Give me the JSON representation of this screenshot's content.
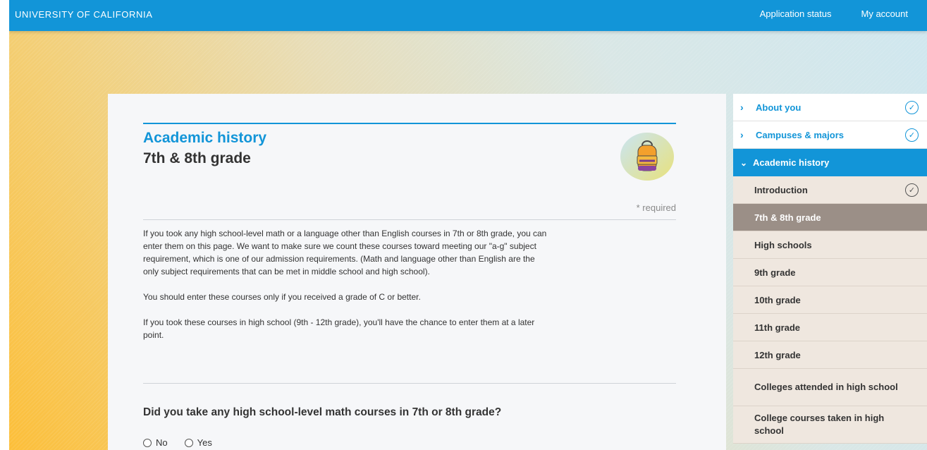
{
  "header": {
    "brand": "UNIVERSITY OF CALIFORNIA",
    "nav": [
      "Application status",
      "My account"
    ]
  },
  "page": {
    "section": "Academic history",
    "subtitle": "7th & 8th grade",
    "required_note": "* required",
    "paragraphs": [
      "If you took any high school-level math or a language other than English courses in 7th or 8th grade, you can enter them on this page. We want to make sure we count these courses toward meeting our \"a-g\" subject requirement, which is one of our admission requirements. (Math and language other than English are the only subject requirements that can be met in middle school and high school).",
      "You should enter these courses only if you received a grade of C or better.",
      "If you took these courses in high school (9th - 12th grade), you'll have the chance to enter them at a later point."
    ],
    "question": "Did you take any high school-level math courses in 7th or 8th grade?",
    "options": [
      "No",
      "Yes"
    ]
  },
  "sidebar": {
    "sections": [
      {
        "label": "About you",
        "icon": "chevron-right-icon",
        "status": "complete"
      },
      {
        "label": "Campuses & majors",
        "icon": "chevron-right-icon",
        "status": "complete"
      },
      {
        "label": "Academic history",
        "icon": "chevron-down-icon",
        "status": "open"
      }
    ],
    "subitems": [
      {
        "label": "Introduction",
        "status": "complete"
      },
      {
        "label": "7th & 8th grade",
        "status": "active"
      },
      {
        "label": "High schools"
      },
      {
        "label": "9th grade"
      },
      {
        "label": "10th grade"
      },
      {
        "label": "11th grade"
      },
      {
        "label": "12th grade"
      },
      {
        "label": "Colleges attended in high school"
      },
      {
        "label": "College courses taken in high school"
      }
    ]
  },
  "icons": {
    "complete": "checkmark-circle-icon",
    "badge": "backpack-icon",
    "chevron_closed": "›",
    "chevron_open": "⌄",
    "check_glyph": "✓"
  },
  "colors": {
    "brand_blue": "#1295d8",
    "active_subitem": "#9b8f87",
    "subitem_bg": "#efe7df"
  }
}
